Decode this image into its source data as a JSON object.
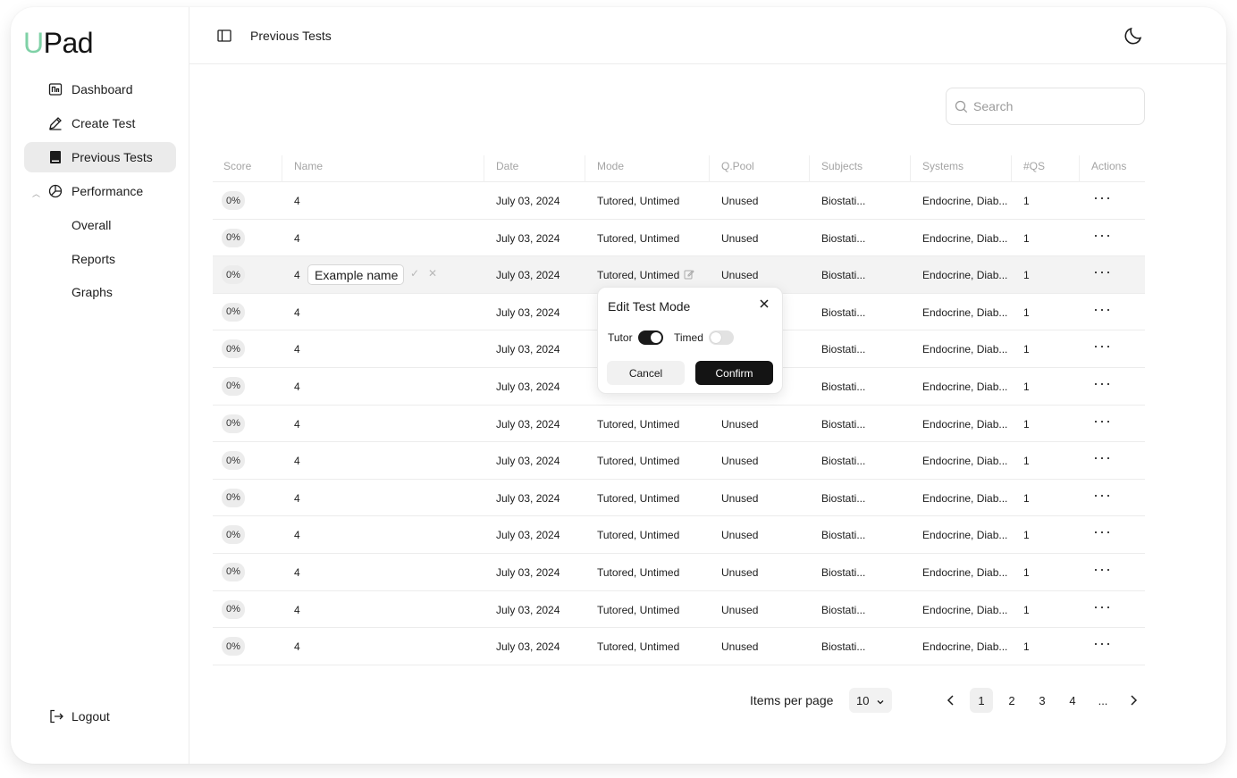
{
  "brand": {
    "logo_first": "U",
    "logo_rest": "Pad"
  },
  "sidebar": {
    "items": [
      {
        "label": "Dashboard",
        "icon": "dashboard-icon"
      },
      {
        "label": "Create Test",
        "icon": "pencil-icon"
      },
      {
        "label": "Previous Tests",
        "icon": "book-icon",
        "active": true
      },
      {
        "label": "Performance",
        "icon": "chart-pie-icon",
        "expanded": true
      }
    ],
    "sub_items": [
      "Overall",
      "Reports",
      "Graphs"
    ],
    "logout_label": "Logout"
  },
  "header": {
    "title": "Previous Tests"
  },
  "search": {
    "placeholder": "Search"
  },
  "table": {
    "columns": [
      "Score",
      "Name",
      "Date",
      "Mode",
      "Q.Pool",
      "Subjects",
      "Systems",
      "#QS",
      "Actions"
    ],
    "rows": [
      {
        "score": "0%",
        "name": "4",
        "date": "July 03, 2024",
        "mode": "Tutored, Untimed",
        "pool": "Unused",
        "subjects": "Biostati...",
        "systems": "Endocrine, Diab...",
        "qs": "1"
      },
      {
        "score": "0%",
        "name": "4",
        "date": "July 03, 2024",
        "mode": "Tutored, Untimed",
        "pool": "Unused",
        "subjects": "Biostati...",
        "systems": "Endocrine, Diab...",
        "qs": "1"
      },
      {
        "score": "0%",
        "name": "4",
        "date": "July 03, 2024",
        "mode": "Tutored, Untimed",
        "pool": "Unused",
        "subjects": "Biostati...",
        "systems": "Endocrine, Diab...",
        "qs": "1",
        "editing_name": "Example name"
      },
      {
        "score": "0%",
        "name": "4",
        "date": "July 03, 2024",
        "mode": "",
        "pool": "",
        "subjects": "Biostati...",
        "systems": "Endocrine, Diab...",
        "qs": "1"
      },
      {
        "score": "0%",
        "name": "4",
        "date": "July 03, 2024",
        "mode": "",
        "pool": "",
        "subjects": "Biostati...",
        "systems": "Endocrine, Diab...",
        "qs": "1"
      },
      {
        "score": "0%",
        "name": "4",
        "date": "July 03, 2024",
        "mode": "",
        "pool": "",
        "subjects": "Biostati...",
        "systems": "Endocrine, Diab...",
        "qs": "1"
      },
      {
        "score": "0%",
        "name": "4",
        "date": "July 03, 2024",
        "mode": "Tutored, Untimed",
        "pool": "Unused",
        "subjects": "Biostati...",
        "systems": "Endocrine, Diab...",
        "qs": "1"
      },
      {
        "score": "0%",
        "name": "4",
        "date": "July 03, 2024",
        "mode": "Tutored, Untimed",
        "pool": "Unused",
        "subjects": "Biostati...",
        "systems": "Endocrine, Diab...",
        "qs": "1"
      },
      {
        "score": "0%",
        "name": "4",
        "date": "July 03, 2024",
        "mode": "Tutored, Untimed",
        "pool": "Unused",
        "subjects": "Biostati...",
        "systems": "Endocrine, Diab...",
        "qs": "1"
      },
      {
        "score": "0%",
        "name": "4",
        "date": "July 03, 2024",
        "mode": "Tutored, Untimed",
        "pool": "Unused",
        "subjects": "Biostati...",
        "systems": "Endocrine, Diab...",
        "qs": "1"
      },
      {
        "score": "0%",
        "name": "4",
        "date": "July 03, 2024",
        "mode": "Tutored, Untimed",
        "pool": "Unused",
        "subjects": "Biostati...",
        "systems": "Endocrine, Diab...",
        "qs": "1"
      },
      {
        "score": "0%",
        "name": "4",
        "date": "July 03, 2024",
        "mode": "Tutored, Untimed",
        "pool": "Unused",
        "subjects": "Biostati...",
        "systems": "Endocrine, Diab...",
        "qs": "1"
      },
      {
        "score": "0%",
        "name": "4",
        "date": "July 03, 2024",
        "mode": "Tutored, Untimed",
        "pool": "Unused",
        "subjects": "Biostati...",
        "systems": "Endocrine, Diab...",
        "qs": "1"
      }
    ],
    "actions_glyph": "···"
  },
  "edit_popover": {
    "title": "Edit Test Mode",
    "tutor_label": "Tutor",
    "tutor_on": true,
    "timed_label": "Timed",
    "timed_on": false,
    "cancel_label": "Cancel",
    "confirm_label": "Confirm"
  },
  "pagination": {
    "items_per_page_label": "Items per page",
    "items_per_page_value": "10",
    "pages": [
      "1",
      "2",
      "3",
      "4",
      "..."
    ],
    "current_page": "1"
  },
  "colors": {
    "brand_accent": "#7fd1a6",
    "primary_dark": "#141414"
  }
}
